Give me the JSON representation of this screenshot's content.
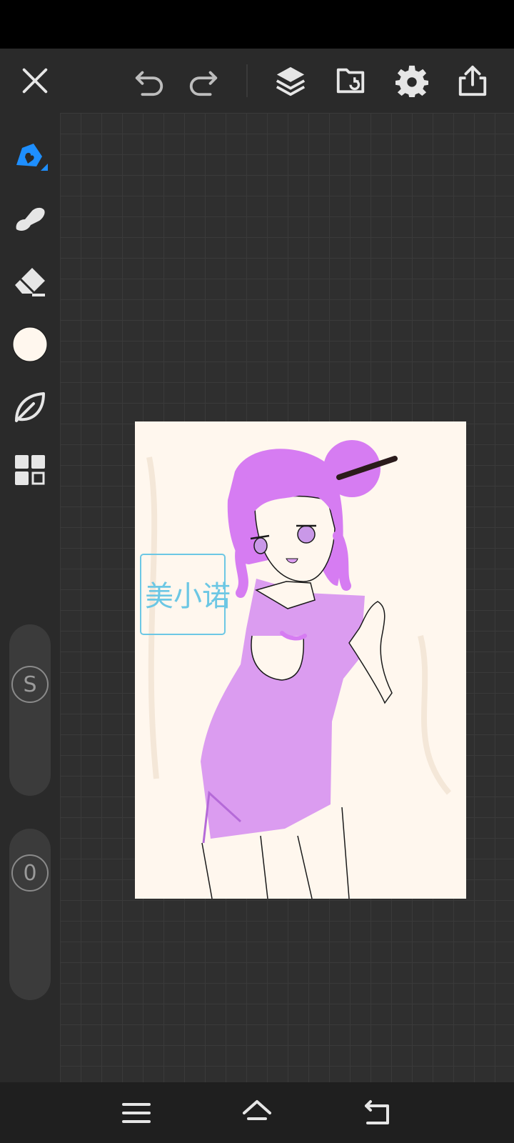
{
  "app": {
    "accent_color": "#1e8fff",
    "brush_color": "#fff7ee"
  },
  "toolbar": {
    "icons": [
      "close-icon",
      "undo-icon",
      "redo-icon",
      "layers-icon",
      "import-icon",
      "gear-icon",
      "share-icon"
    ]
  },
  "left_tools": {
    "icons": [
      "pen-icon",
      "smudge-icon",
      "eraser-icon",
      "color-swatch",
      "leaf-icon",
      "grid-icon"
    ],
    "size_slider": {
      "label": "S"
    },
    "opacity_slider": {
      "label": "0"
    }
  },
  "artwork": {
    "signature": "美小诺",
    "hair_color": "#d67cf2",
    "dress_color": "#db9cf0"
  },
  "nav": {
    "icons": [
      "menu-icon",
      "home-icon",
      "back-icon"
    ]
  }
}
